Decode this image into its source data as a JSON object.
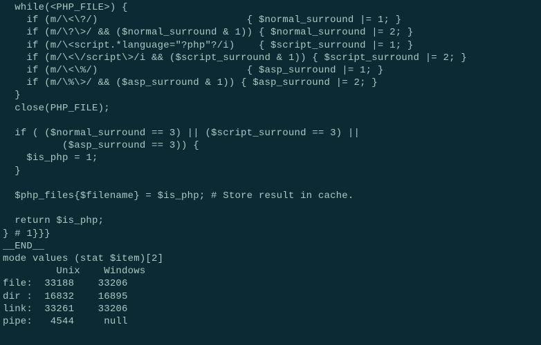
{
  "code_lines": [
    "  while(<PHP_FILE>) {",
    "    if (m/\\<\\?/)                         { $normal_surround |= 1; }",
    "    if (m/\\?\\>/ && ($normal_surround & 1)) { $normal_surround |= 2; }",
    "    if (m/\\<script.*language=\"?php\"?/i)    { $script_surround |= 1; }",
    "    if (m/\\<\\/script\\>/i && ($script_surround & 1)) { $script_surround |= 2; }",
    "    if (m/\\<\\%/)                         { $asp_surround |= 1; }",
    "    if (m/\\%\\>/ && ($asp_surround & 1)) { $asp_surround |= 2; }",
    "  }",
    "  close(PHP_FILE);",
    "",
    "  if ( ($normal_surround == 3) || ($script_surround == 3) ||",
    "          ($asp_surround == 3)) {",
    "    $is_php = 1;",
    "  }",
    "",
    "  $php_files{$filename} = $is_php; # Store result in cache.",
    "",
    "  return $is_php;",
    "} # 1}}}",
    "__END__",
    "mode values (stat $item)[2]",
    "         Unix    Windows",
    "file:  33188    33206",
    "dir :  16832    16895",
    "link:  33261    33206",
    "pipe:   4544     null"
  ]
}
